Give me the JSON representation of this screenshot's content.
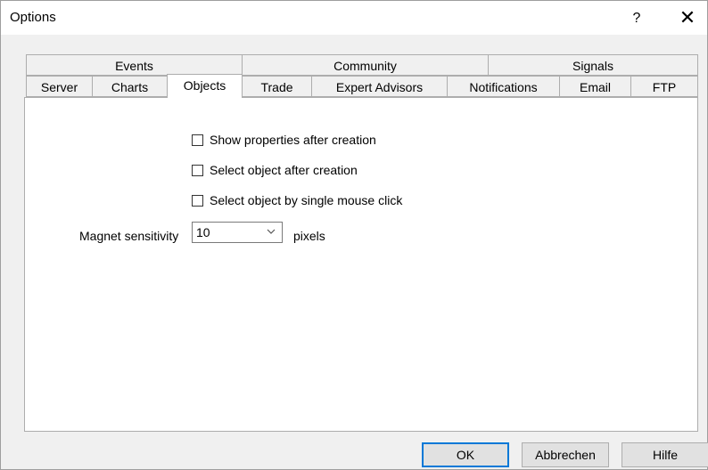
{
  "window": {
    "title": "Options",
    "help_label": "?",
    "close_label": "✕"
  },
  "tabs_row1": [
    {
      "label": "Events"
    },
    {
      "label": "Community"
    },
    {
      "label": "Signals"
    }
  ],
  "tabs_row2": [
    {
      "label": "Server"
    },
    {
      "label": "Charts"
    },
    {
      "label": "Objects",
      "active": true
    },
    {
      "label": "Trade"
    },
    {
      "label": "Expert Advisors"
    },
    {
      "label": "Notifications"
    },
    {
      "label": "Email"
    },
    {
      "label": "FTP"
    }
  ],
  "options": {
    "show_props": {
      "label": "Show properties after creation",
      "checked": false
    },
    "select_after": {
      "label": "Select object after creation",
      "checked": false
    },
    "single_click": {
      "label": "Select object by single mouse click",
      "checked": false
    }
  },
  "magnet": {
    "label": "Magnet sensitivity",
    "value": "10",
    "unit": "pixels"
  },
  "buttons": {
    "ok": "OK",
    "cancel": "Abbrechen",
    "help": "Hilfe"
  }
}
